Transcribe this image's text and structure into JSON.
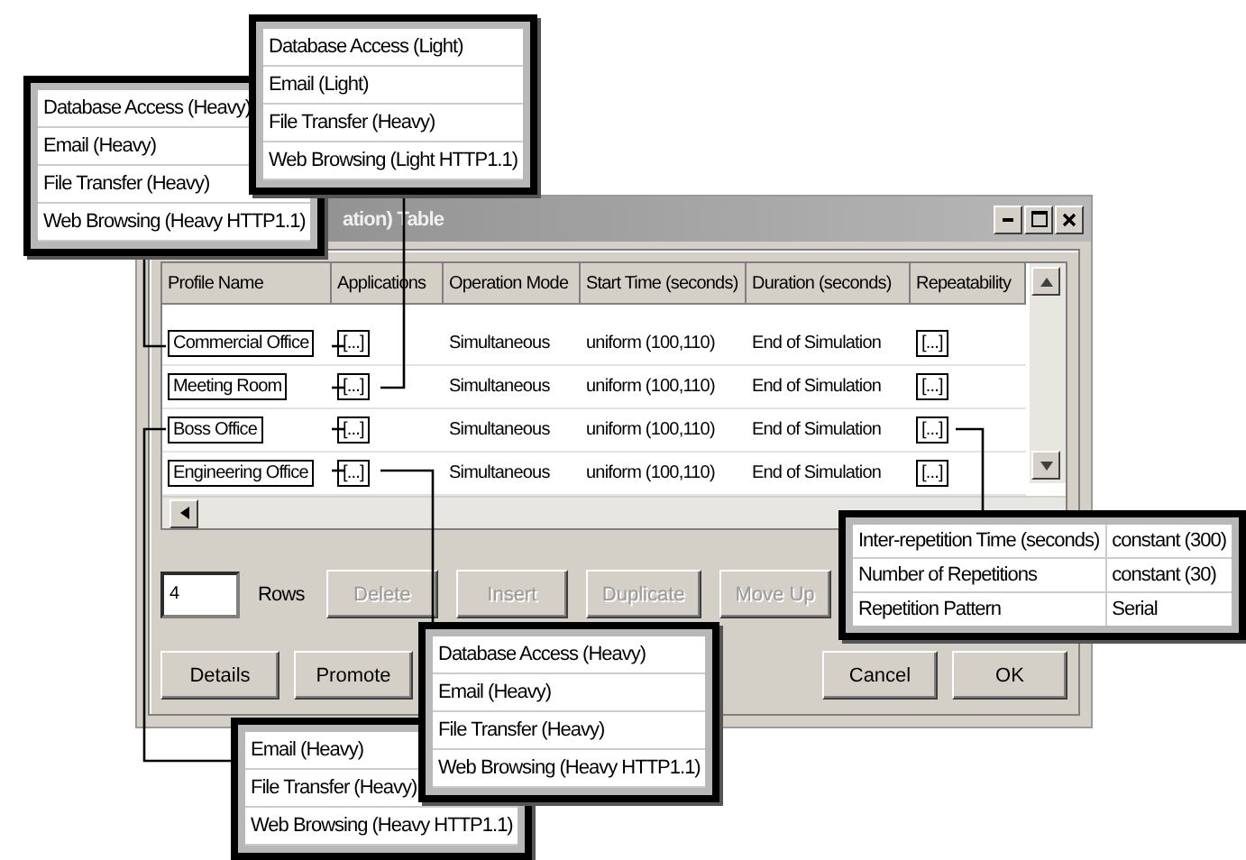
{
  "dialog": {
    "title": "ation) Table",
    "table": {
      "columns": [
        "Profile Name",
        "Applications",
        "Operation Mode",
        "Start Time (seconds)",
        "Duration (seconds)",
        "Repeatability"
      ],
      "rows": [
        {
          "name": "Commercial Office",
          "applications": "[...]",
          "mode": "Simultaneous",
          "start": "uniform (100,110)",
          "duration": "End of Simulation",
          "repeatability": "[...]"
        },
        {
          "name": "Meeting Room",
          "applications": "[...]",
          "mode": "Simultaneous",
          "start": "uniform (100,110)",
          "duration": "End of Simulation",
          "repeatability": "[...]"
        },
        {
          "name": "Boss Office",
          "applications": "[...]",
          "mode": "Simultaneous",
          "start": "uniform (100,110)",
          "duration": "End of Simulation",
          "repeatability": "[...]"
        },
        {
          "name": "Engineering Office",
          "applications": "[...]",
          "mode": "Simultaneous",
          "start": "uniform (100,110)",
          "duration": "End of Simulation",
          "repeatability": "[...]"
        }
      ]
    },
    "rows_field": {
      "value": "4",
      "label": "Rows"
    },
    "edit_buttons": [
      {
        "label": "Delete",
        "disabled": true
      },
      {
        "label": "Insert",
        "disabled": true
      },
      {
        "label": "Duplicate",
        "disabled": true
      },
      {
        "label": "Move Up",
        "disabled": true
      }
    ],
    "action_buttons": [
      {
        "label": "Details",
        "disabled": false
      },
      {
        "label": "Promote",
        "disabled": false
      },
      {
        "label": "Cancel",
        "disabled": false
      },
      {
        "label": "OK",
        "disabled": false
      }
    ]
  },
  "callouts": [
    {
      "kind": "list",
      "items": [
        "Database Access (Heavy)",
        "Email (Heavy)",
        "File Transfer (Heavy)",
        "Web Browsing (Heavy HTTP1.1)"
      ]
    },
    {
      "kind": "list",
      "items": [
        "Database Access (Light)",
        "Email (Light)",
        "File Transfer (Heavy)",
        "Web Browsing (Light HTTP1.1)"
      ]
    },
    {
      "kind": "table",
      "rows": [
        [
          "Inter-repetition Time (seconds)",
          "constant (300)"
        ],
        [
          "Number of Repetitions",
          "constant (30)"
        ],
        [
          "Repetition Pattern",
          "Serial"
        ]
      ]
    },
    {
      "kind": "list",
      "items": [
        "Email (Heavy)",
        "File Transfer (Heavy)",
        "Web Browsing (Heavy HTTP1.1)"
      ]
    },
    {
      "kind": "list",
      "items": [
        "Database Access (Heavy)",
        "Email (Heavy)",
        "File Transfer (Heavy)",
        "Web Browsing (Heavy HTTP1.1)"
      ]
    }
  ]
}
